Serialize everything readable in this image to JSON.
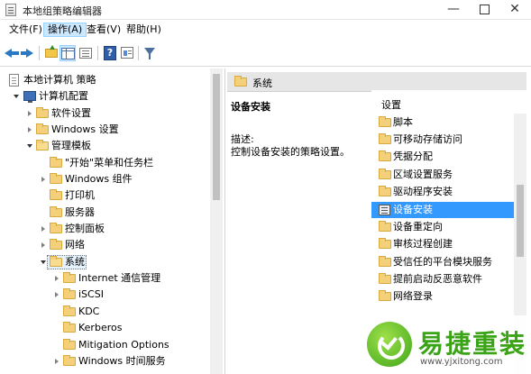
{
  "window": {
    "title": "本地组策略编辑器",
    "min_glyph": "—",
    "close_glyph": "✕"
  },
  "menu": {
    "items": [
      {
        "label": "文件(F)"
      },
      {
        "label": "操作(A)"
      },
      {
        "label": "查看(V)"
      },
      {
        "label": "帮助(H)"
      }
    ]
  },
  "toolbar": {
    "help_glyph": "?"
  },
  "tree": {
    "root": "本地计算机 策略",
    "computer_config": "计算机配置",
    "software_settings": "软件设置",
    "windows_settings": "Windows 设置",
    "admin_templates": "管理模板",
    "start_menu": "\"开始\"菜单和任务栏",
    "windows_components": "Windows 组件",
    "printers": "打印机",
    "server": "服务器",
    "control_panel": "控制面板",
    "network": "网络",
    "system": "系统",
    "internet_comm": "Internet 通信管理",
    "iscsi": "iSCSI",
    "kdc": "KDC",
    "kerberos": "Kerberos",
    "mitigation": "Mitigation Options",
    "windows_time": "Windows 时间服务"
  },
  "details": {
    "header": "系统",
    "selected_title": "设备安装",
    "desc_label": "描述:",
    "desc_text": "控制设备安装的策略设置。",
    "column": "设置",
    "items": [
      {
        "label": "脚本",
        "icon": "folder-icon"
      },
      {
        "label": "可移动存储访问",
        "icon": "folder-icon"
      },
      {
        "label": "凭据分配",
        "icon": "folder-icon"
      },
      {
        "label": "区域设置服务",
        "icon": "folder-icon"
      },
      {
        "label": "驱动程序安装",
        "icon": "folder-icon"
      },
      {
        "label": "设备安装",
        "icon": "policy-icon"
      },
      {
        "label": "设备重定向",
        "icon": "folder-icon"
      },
      {
        "label": "审核过程创建",
        "icon": "folder-icon"
      },
      {
        "label": "受信任的平台模块服务",
        "icon": "folder-icon"
      },
      {
        "label": "提前启动反恶意软件",
        "icon": "folder-icon"
      },
      {
        "label": "网络登录",
        "icon": "folder-icon"
      }
    ]
  },
  "watermark": {
    "title": "易捷重装",
    "url": "www.yjxitong.com"
  }
}
